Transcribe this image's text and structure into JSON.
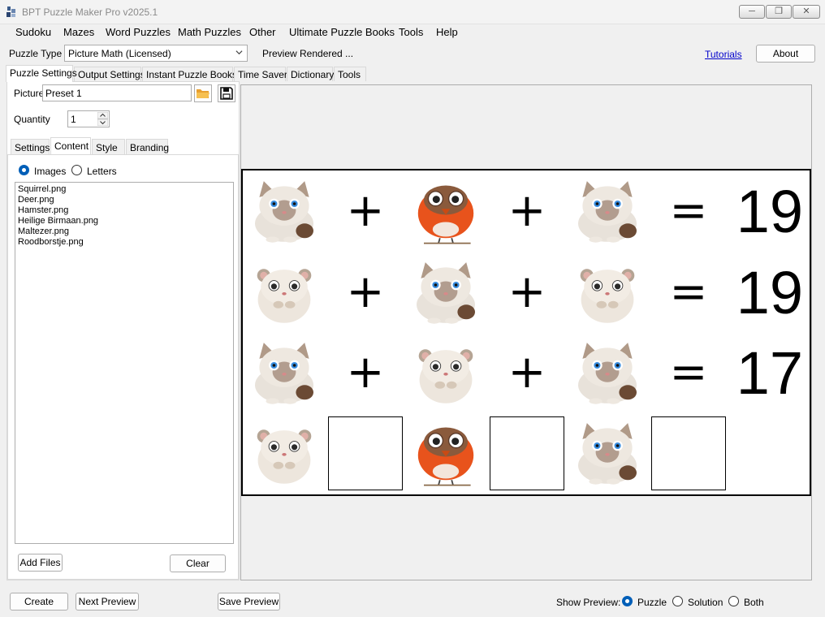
{
  "window": {
    "title": "BPT Puzzle Maker Pro v2025.1",
    "minimize_label": "─",
    "restore_label": "❐",
    "close_label": "✕"
  },
  "menu": [
    "Sudoku",
    "Mazes",
    "Word Puzzles",
    "Math Puzzles",
    "Other",
    "Ultimate Puzzle Books",
    "Tools",
    "Help"
  ],
  "type_bar": {
    "label": "Puzzle Type",
    "value": "Picture Math (Licensed)",
    "status": "Preview Rendered ...",
    "tutorials": "Tutorials",
    "about": "About"
  },
  "tabs": [
    "Puzzle Settings",
    "Output Settings",
    "Instant Puzzle Books",
    "Time Saver",
    "Dictionary",
    "Tools"
  ],
  "settings": {
    "picture_label": "Picture",
    "picture_value": "Preset 1",
    "quantity_label": "Quantity",
    "quantity_value": "1",
    "subtabs": [
      "Settings",
      "Content",
      "Style",
      "Branding"
    ],
    "radio_images": "Images",
    "radio_letters": "Letters",
    "files": [
      "Squirrel.png",
      "Deer.png",
      "Hamster.png",
      "Heilige Birmaan.png",
      "Maltezer.png",
      "Roodborstje.png"
    ],
    "add_files": "Add Files",
    "clear": "Clear"
  },
  "puzzle": {
    "rows": [
      {
        "items": [
          "cat",
          "+",
          "robin",
          "+",
          "cat",
          "="
        ],
        "result": "19"
      },
      {
        "items": [
          "hamster",
          "+",
          "cat",
          "+",
          "hamster",
          "="
        ],
        "result": "19"
      },
      {
        "items": [
          "cat",
          "+",
          "hamster",
          "+",
          "cat",
          "="
        ],
        "result": "17"
      },
      {
        "items": [
          "hamster",
          "box",
          "robin",
          "box",
          "cat",
          "box"
        ],
        "result": ""
      }
    ]
  },
  "bottom": {
    "create": "Create",
    "next_preview": "Next Preview",
    "save_preview": "Save Preview",
    "show_preview_label": "Show Preview:",
    "opt_puzzle": "Puzzle",
    "opt_solution": "Solution",
    "opt_both": "Both"
  },
  "colors": {
    "accent": "#005fb8",
    "link": "#0000cc",
    "robin_orange": "#e8531c",
    "folder": "#f0a030"
  }
}
